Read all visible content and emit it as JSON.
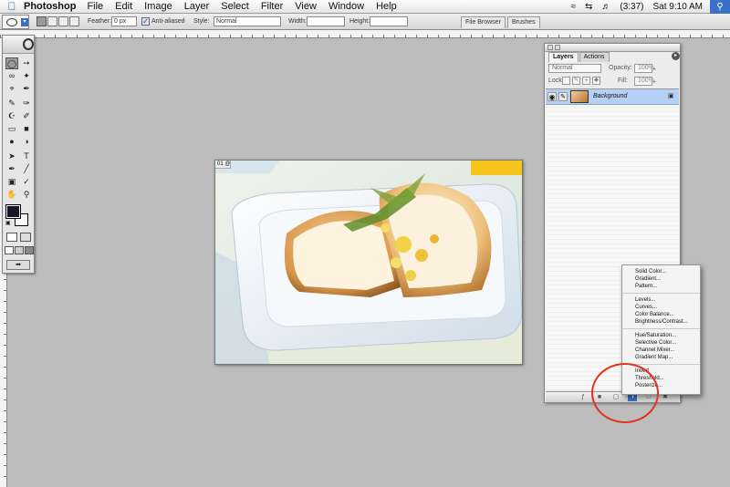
{
  "menubar": {
    "app_name": "Photoshop",
    "items": [
      "File",
      "Edit",
      "Image",
      "Layer",
      "Select",
      "Filter",
      "View",
      "Window",
      "Help"
    ],
    "battery": "(3:37)",
    "clock": "Sat 9:10 AM"
  },
  "options": {
    "feather_label": "Feather:",
    "feather_value": "0 px",
    "antialiased_label": "Anti-aliased",
    "style_label": "Style:",
    "style_value": "Normal",
    "width_label": "Width:",
    "height_label": "Height:",
    "tabs": [
      "File Browser",
      "Brushes"
    ]
  },
  "document": {
    "title": "01 @"
  },
  "layers_panel": {
    "tabs": [
      "Layers",
      "Actions"
    ],
    "blend_mode": "Normal",
    "opacity_label": "Opacity:",
    "opacity_value": "100%",
    "lock_label": "Lock:",
    "fill_label": "Fill:",
    "fill_value": "100%",
    "layer_name": "Background"
  },
  "adjustment_menu": {
    "groups": [
      [
        "Solid Color...",
        "Gradient...",
        "Pattern..."
      ],
      [
        "Levels...",
        "Curves...",
        "Color Balance...",
        "Brightness/Contrast..."
      ],
      [
        "Hue/Saturation...",
        "Selective Color...",
        "Channel Mixer...",
        "Gradient Map..."
      ],
      [
        "Invert",
        "Threshold...",
        "Posterize..."
      ]
    ]
  },
  "colors": {
    "annotation_circle": "#e0341e",
    "selected_layer": "#b5cff5",
    "canvas_bg": "#bdbdbd"
  }
}
